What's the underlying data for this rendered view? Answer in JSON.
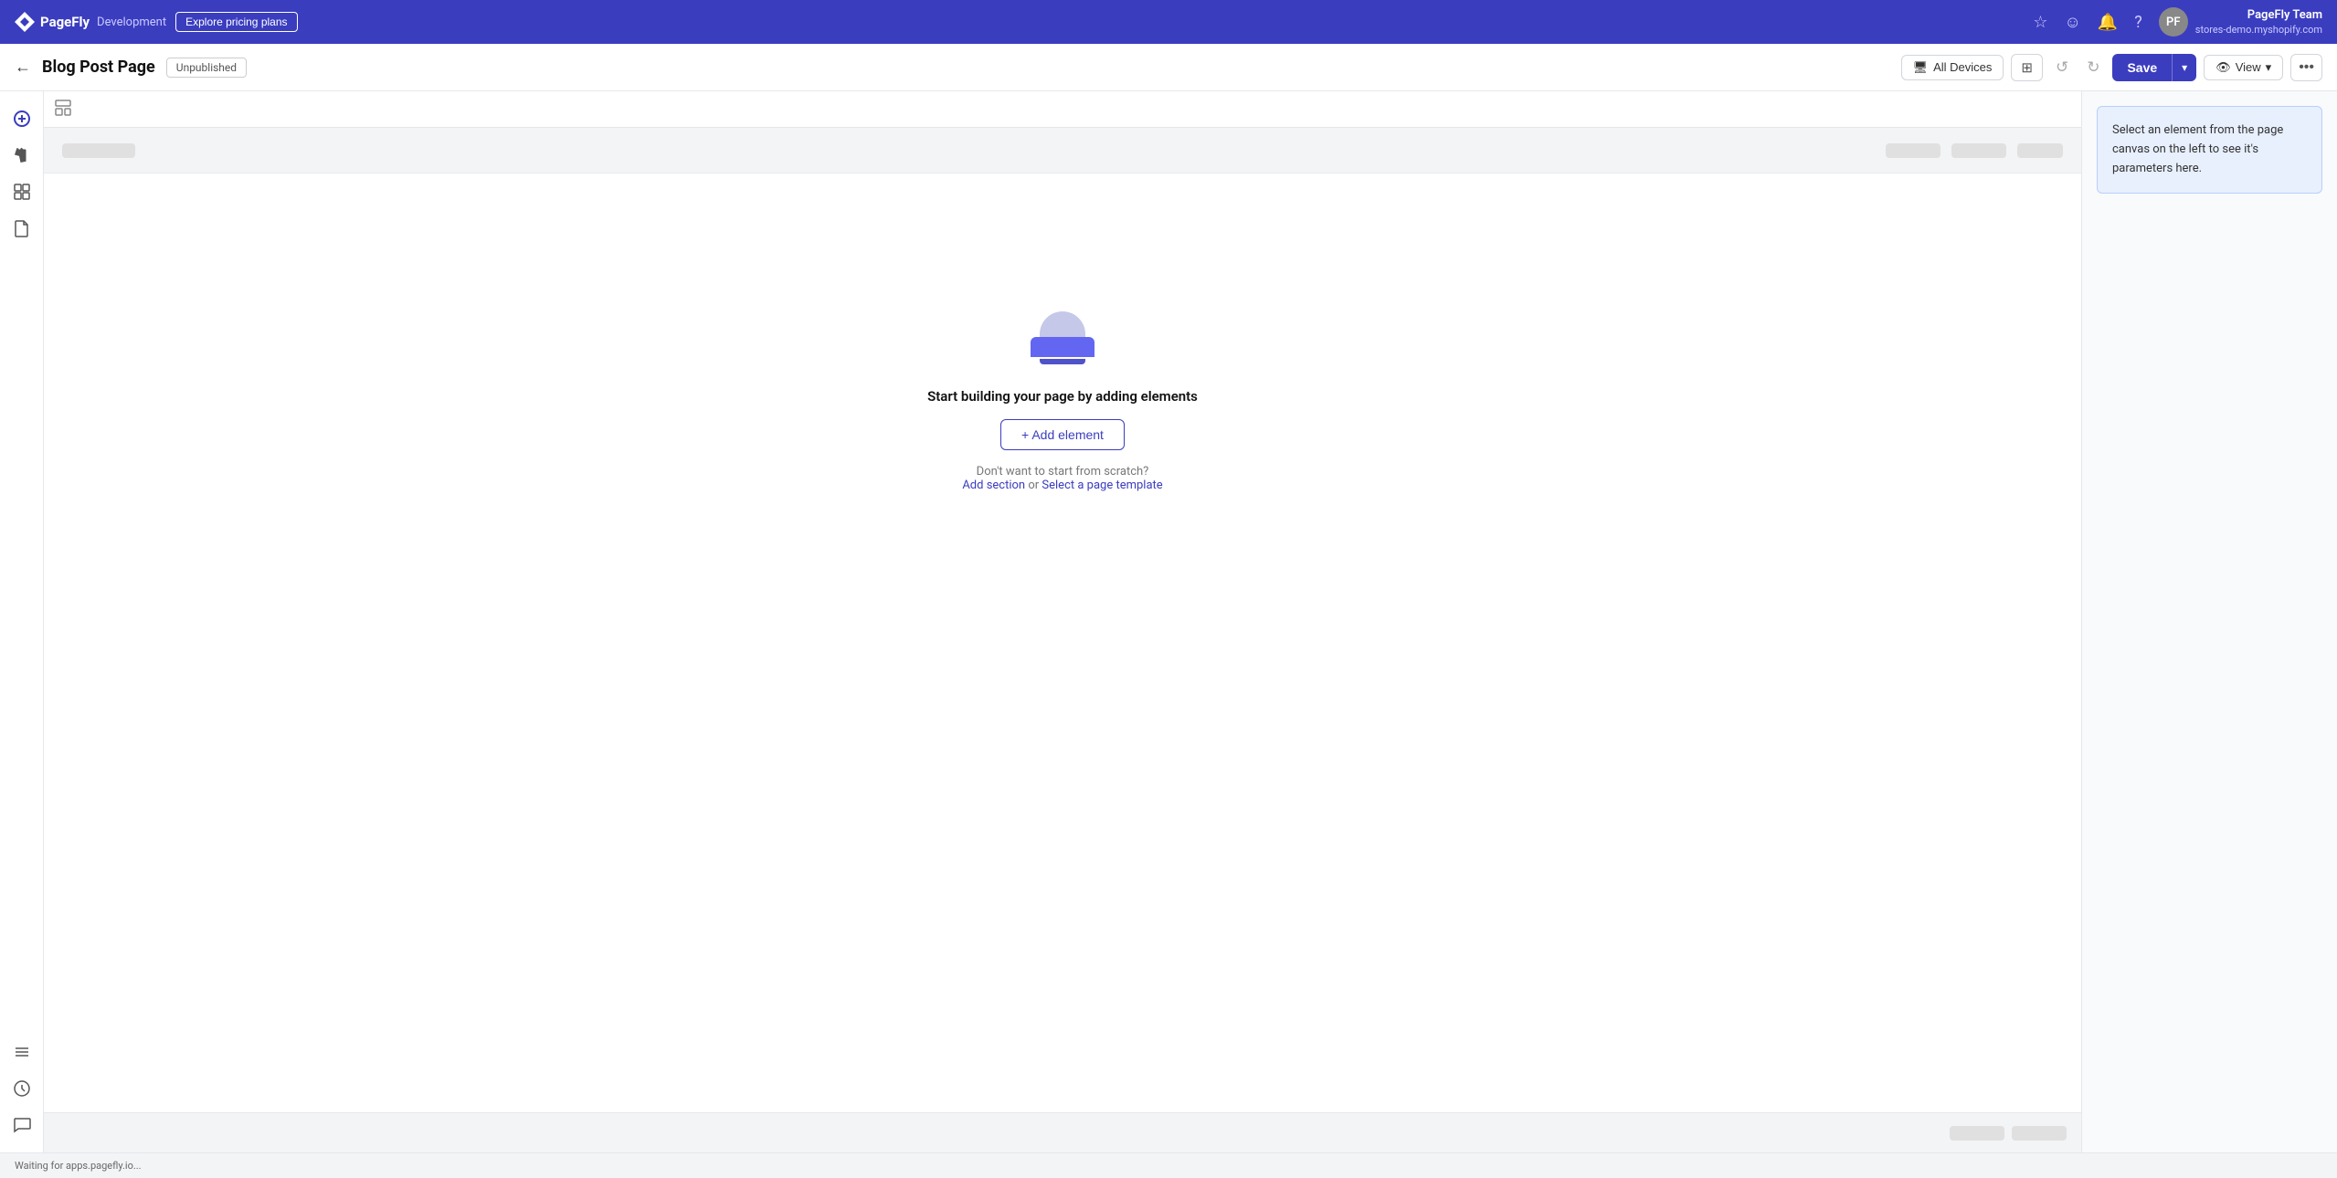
{
  "topNav": {
    "brandName": "PageFly",
    "brandEnv": "Development",
    "exploreBtn": "Explore pricing plans",
    "user": {
      "name": "PageFly Team",
      "store": "stores-demo.myshopify.com",
      "initials": "PF"
    }
  },
  "toolbar": {
    "backLabel": "←",
    "pageTitle": "Blog Post Page",
    "statusBadge": "Unpublished",
    "devicesLabel": "All Devices",
    "saveLabel": "Save",
    "viewLabel": "View"
  },
  "canvas": {
    "emptyTitle": "Start building your page by adding elements",
    "addElementLabel": "+ Add element",
    "scratchText": "Don't want to start from scratch?",
    "addSectionLabel": "Add section",
    "orLabel": " or ",
    "selectTemplateLabel": "Select a page template"
  },
  "rightPanel": {
    "infoText": "Select an element from the page canvas on the left to see it's parameters here."
  },
  "statusBar": {
    "text": "Waiting for apps.pagefly.io..."
  }
}
